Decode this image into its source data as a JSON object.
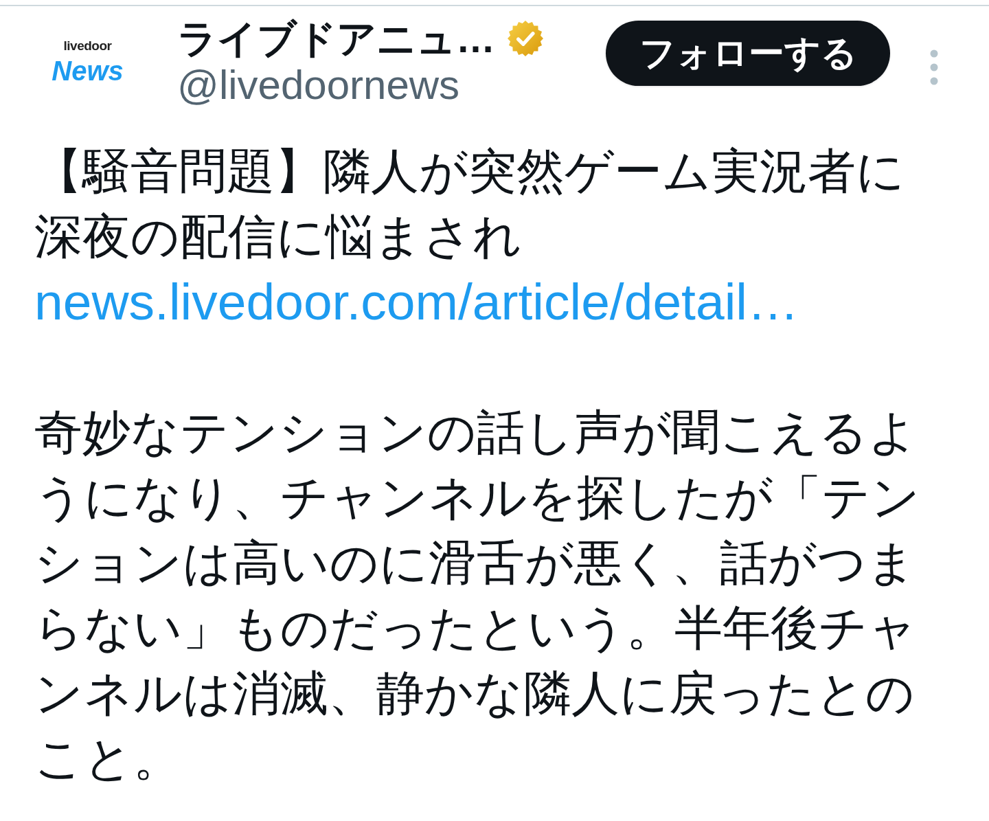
{
  "account": {
    "avatar": {
      "logo_top": "livedoor",
      "logo_bottom": "News"
    },
    "name": "ライブドアニュ…",
    "verified": true,
    "handle": "@livedoornews"
  },
  "follow_button": {
    "label": "フォローする"
  },
  "tweet": {
    "headline": "【騒音問題】隣人が突然ゲーム実況者に深夜の配信に悩まされ",
    "link": "news.livedoor.com/article/detail…",
    "body": "奇妙なテンションの話し声が聞こえるようになり、チャンネルを探したが「テンションは高いのに滑舌が悪く、話がつまらない」ものだったという。半年後チャンネルは消滅、静かな隣人に戻ったとのこと。"
  }
}
